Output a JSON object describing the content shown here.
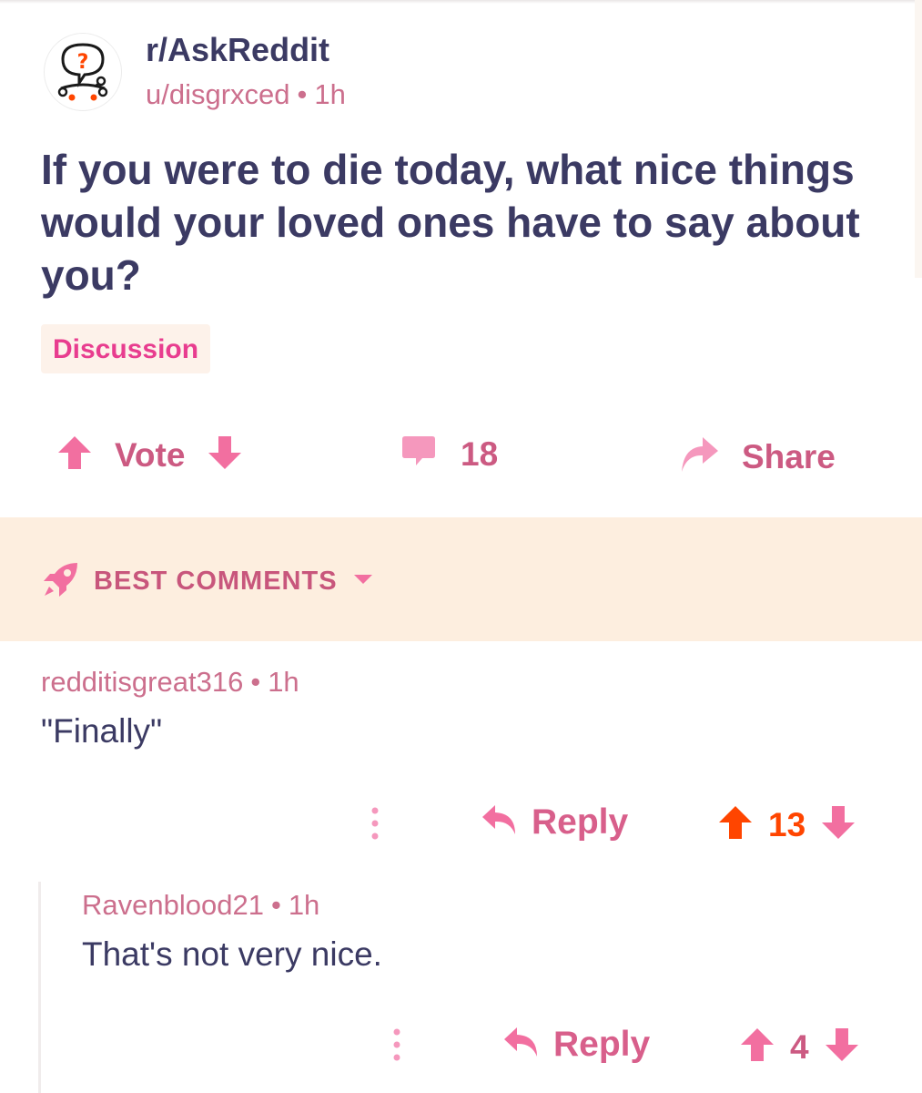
{
  "header": {
    "subreddit": "r/AskReddit",
    "author": "u/disgrxced",
    "age": "1h"
  },
  "post": {
    "title": "If you were to die today, what nice things would your loved ones have to say about you?",
    "flair": "Discussion"
  },
  "actions": {
    "vote_label": "Vote",
    "comment_count": "18",
    "share_label": "Share"
  },
  "sort": {
    "label": "BEST COMMENTS"
  },
  "comments": [
    {
      "author": "redditisgreat316",
      "age": "1h",
      "body": "\"Finally\"",
      "reply_label": "Reply",
      "score": "13",
      "upvoted": true
    },
    {
      "author": "Ravenblood21",
      "age": "1h",
      "body": "That's not very nice.",
      "reply_label": "Reply",
      "score": "4",
      "upvoted": false
    }
  ],
  "colors": {
    "text": "#3b3a63",
    "accent_pink": "#d85f8b",
    "upvote_orange": "#ff4500",
    "sort_bar_bg": "#fdeedf"
  }
}
